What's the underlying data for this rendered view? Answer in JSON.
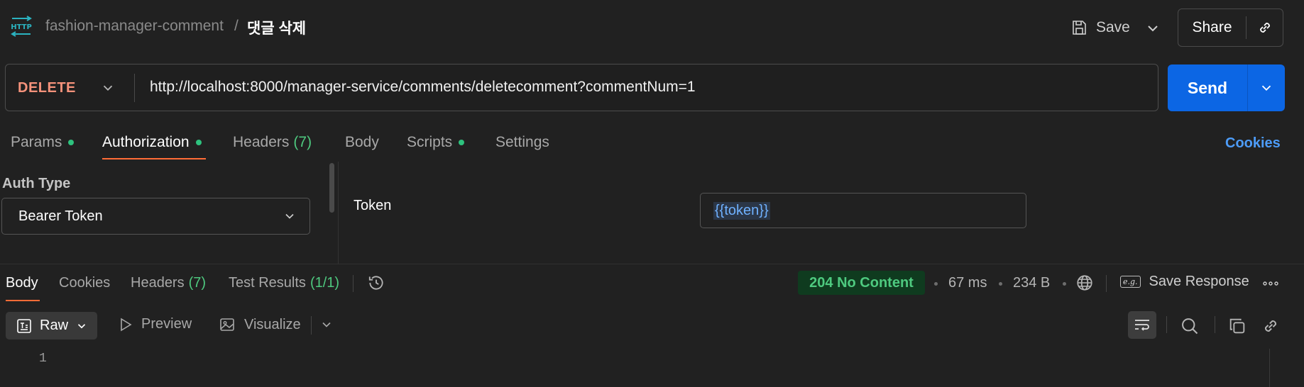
{
  "header": {
    "icon_text": "HTTP",
    "breadcrumb_parent": "fashion-manager-comment",
    "breadcrumb_separator": "/",
    "breadcrumb_current": "댓글 삭제",
    "save_label": "Save",
    "share_label": "Share"
  },
  "request": {
    "method": "DELETE",
    "url": "http://localhost:8000/manager-service/comments/deletecomment?commentNum=1",
    "send_label": "Send"
  },
  "request_tabs": {
    "params": "Params",
    "authorization": "Authorization",
    "headers": "Headers",
    "headers_count": "(7)",
    "body": "Body",
    "scripts": "Scripts",
    "settings": "Settings",
    "cookies": "Cookies"
  },
  "auth": {
    "type_label": "Auth Type",
    "type_value": "Bearer Token",
    "token_label": "Token",
    "token_value": "{{token}}"
  },
  "response_tabs": {
    "body": "Body",
    "cookies": "Cookies",
    "headers": "Headers",
    "headers_count": "(7)",
    "test_results": "Test Results",
    "test_results_count": "(1/1)"
  },
  "response_meta": {
    "status": "204 No Content",
    "time": "67 ms",
    "size": "234 B",
    "save_response": "Save Response",
    "eg_icon_text": "e.g."
  },
  "response_toolbar": {
    "raw": "Raw",
    "preview": "Preview",
    "visualize": "Visualize"
  },
  "editor": {
    "line_number": "1"
  },
  "colors": {
    "accent": "#ff6c37",
    "send": "#0c66e4",
    "method_delete": "#f6927b",
    "success": "#4ec97f",
    "link": "#4d9cf8"
  }
}
